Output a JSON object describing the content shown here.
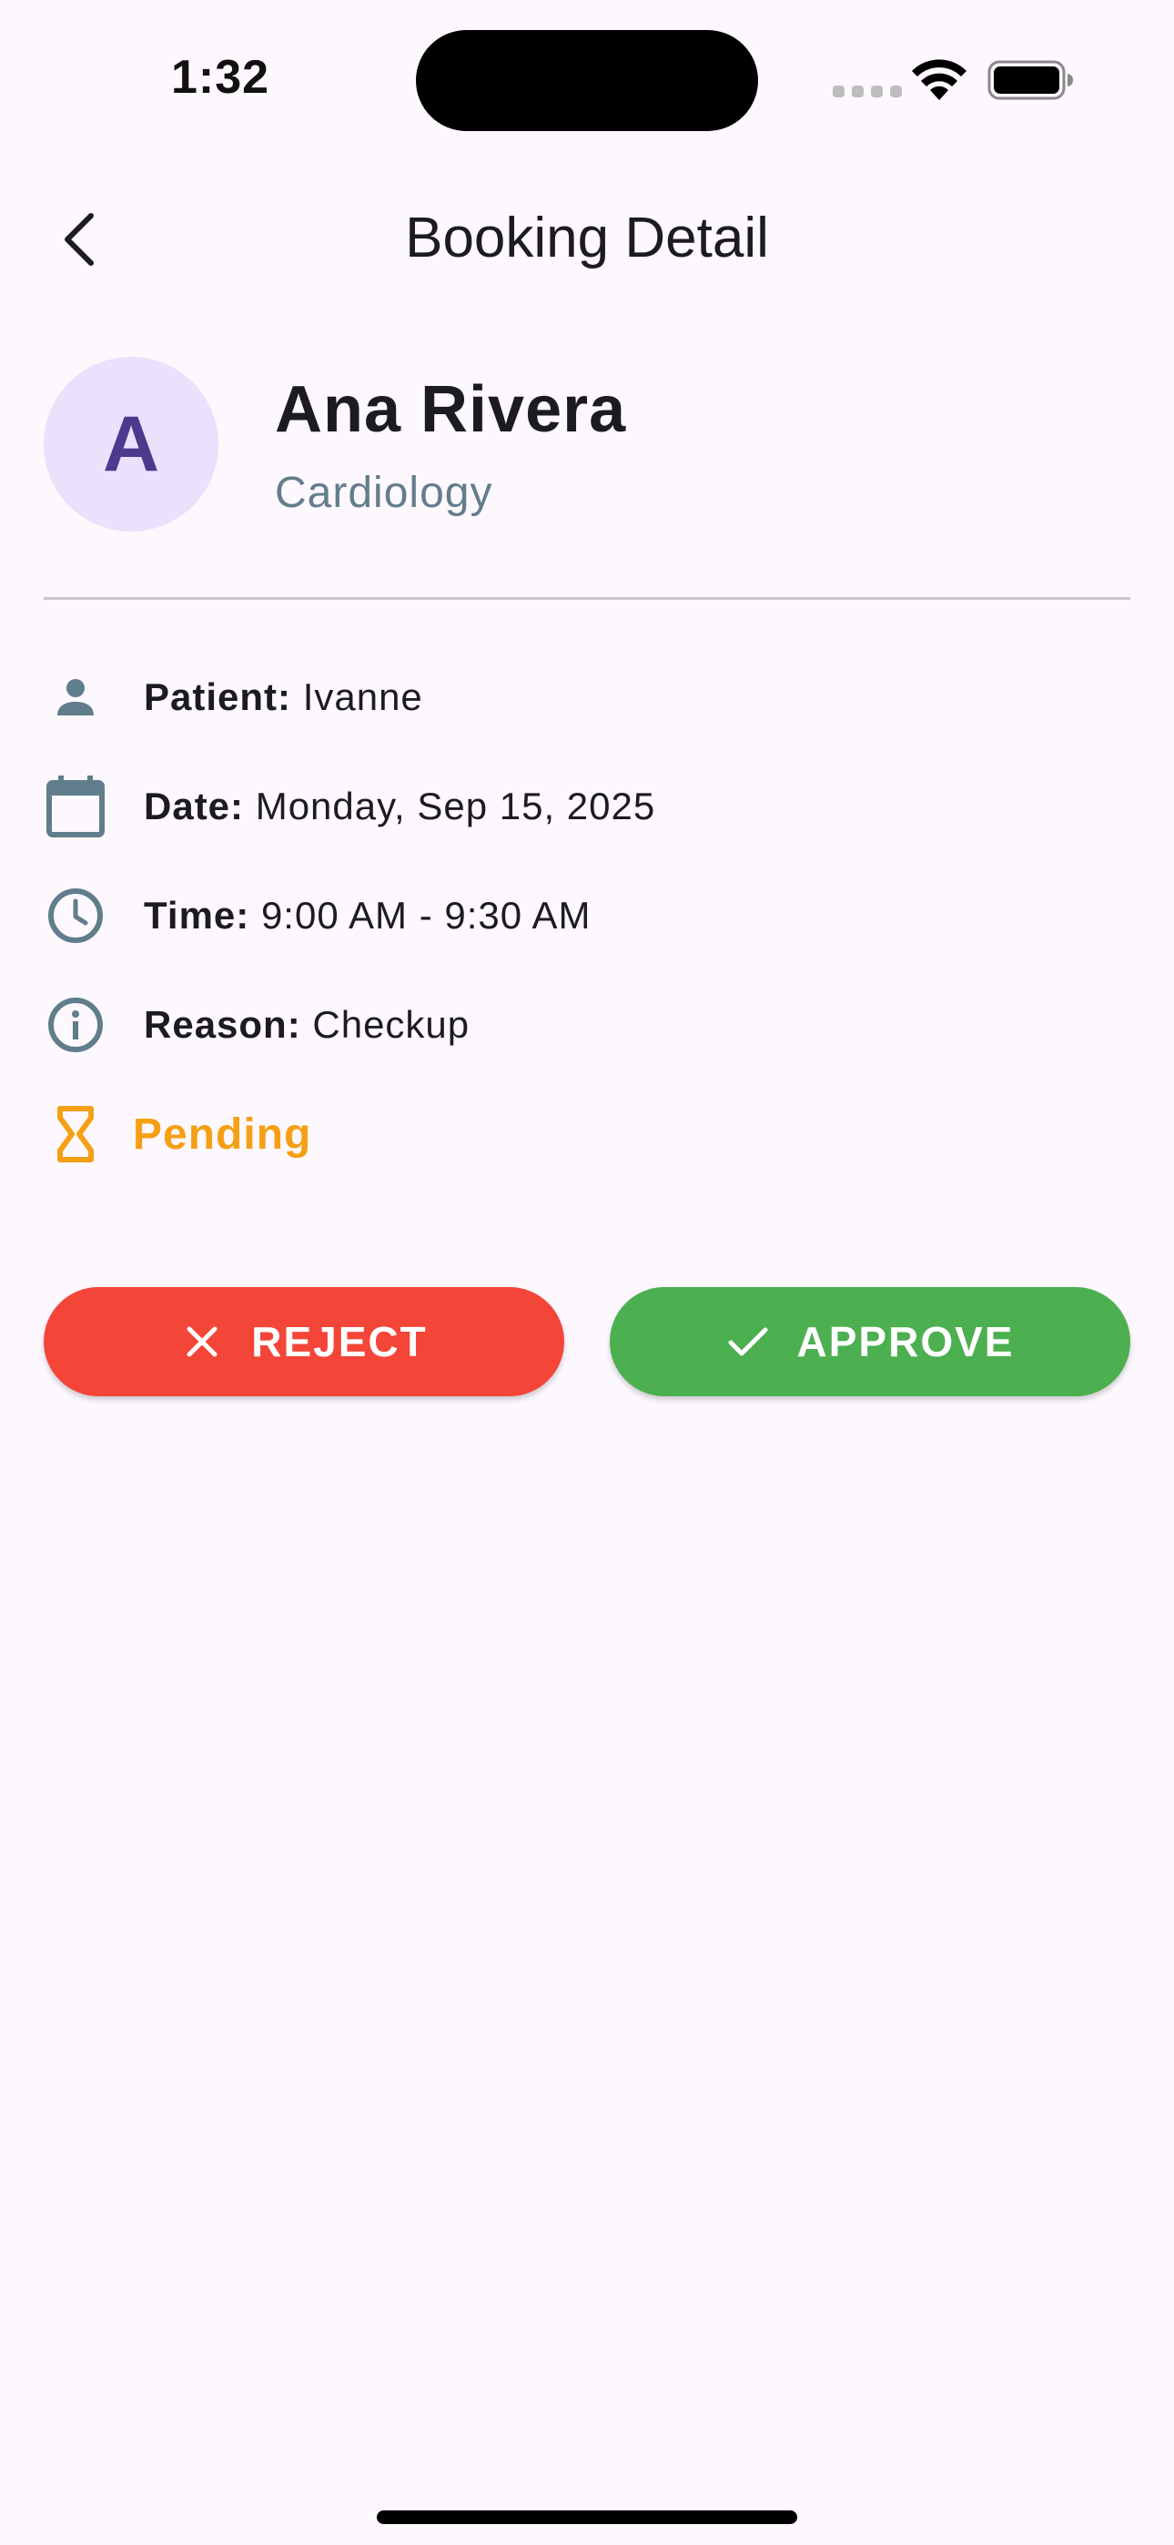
{
  "status_bar": {
    "time": "1:32"
  },
  "app_bar": {
    "title": "Booking Detail",
    "back_icon": "chevron-left-icon"
  },
  "doctor": {
    "avatar_initial": "A",
    "name": "Ana Rivera",
    "specialty": "Cardiology"
  },
  "details": {
    "patient": {
      "label": "Patient:",
      "value": "Ivanne",
      "icon": "person-icon"
    },
    "date": {
      "label": "Date:",
      "value": "Monday, Sep 15, 2025",
      "icon": "calendar-icon"
    },
    "time": {
      "label": "Time:",
      "value": "9:00 AM - 9:30 AM",
      "icon": "clock-icon"
    },
    "reason": {
      "label": "Reason:",
      "value": "Checkup",
      "icon": "info-icon"
    }
  },
  "status": {
    "label": "Pending",
    "icon": "hourglass-icon",
    "color": "#f5a014"
  },
  "actions": {
    "reject_label": "REJECT",
    "approve_label": "APPROVE",
    "reject_color": "#f44539",
    "approve_color": "#4caf50"
  },
  "colors": {
    "background": "#fdf7fe",
    "icon_slate": "#607d8b",
    "avatar_bg": "#ebe1fc",
    "avatar_text": "#4b3a8d"
  }
}
